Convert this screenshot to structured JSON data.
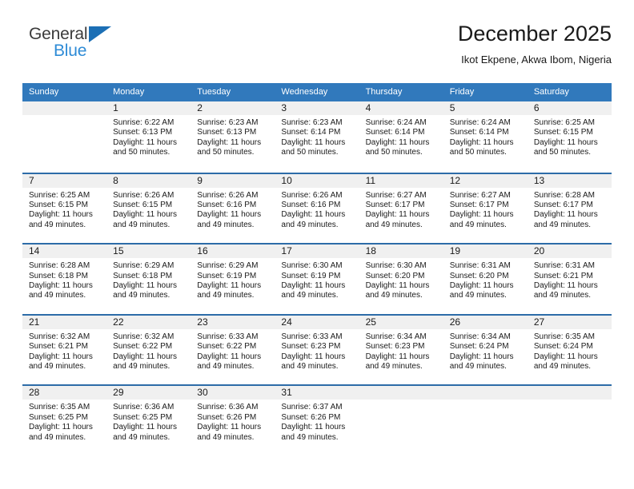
{
  "brand": {
    "name_part1": "General",
    "name_part2": "Blue",
    "accent_color": "#1c6fb5",
    "light_blue": "#2e8bd6"
  },
  "header": {
    "title": "December 2025",
    "subtitle": "Ikot Ekpene, Akwa Ibom, Nigeria"
  },
  "theme": {
    "header_row_bg": "#3179bc",
    "row_divider": "#2d6ca8",
    "daynum_bg": "#f0f0f0"
  },
  "weekdays": [
    "Sunday",
    "Monday",
    "Tuesday",
    "Wednesday",
    "Thursday",
    "Friday",
    "Saturday"
  ],
  "labels": {
    "sunrise_prefix": "Sunrise:",
    "sunset_prefix": "Sunset:",
    "daylight_prefix": "Daylight:"
  },
  "weeks": [
    [
      {
        "day": "",
        "empty": true
      },
      {
        "day": "1",
        "sunrise": "Sunrise: 6:22 AM",
        "sunset": "Sunset: 6:13 PM",
        "daylight1": "Daylight: 11 hours",
        "daylight2": "and 50 minutes."
      },
      {
        "day": "2",
        "sunrise": "Sunrise: 6:23 AM",
        "sunset": "Sunset: 6:13 PM",
        "daylight1": "Daylight: 11 hours",
        "daylight2": "and 50 minutes."
      },
      {
        "day": "3",
        "sunrise": "Sunrise: 6:23 AM",
        "sunset": "Sunset: 6:14 PM",
        "daylight1": "Daylight: 11 hours",
        "daylight2": "and 50 minutes."
      },
      {
        "day": "4",
        "sunrise": "Sunrise: 6:24 AM",
        "sunset": "Sunset: 6:14 PM",
        "daylight1": "Daylight: 11 hours",
        "daylight2": "and 50 minutes."
      },
      {
        "day": "5",
        "sunrise": "Sunrise: 6:24 AM",
        "sunset": "Sunset: 6:14 PM",
        "daylight1": "Daylight: 11 hours",
        "daylight2": "and 50 minutes."
      },
      {
        "day": "6",
        "sunrise": "Sunrise: 6:25 AM",
        "sunset": "Sunset: 6:15 PM",
        "daylight1": "Daylight: 11 hours",
        "daylight2": "and 50 minutes."
      }
    ],
    [
      {
        "day": "7",
        "sunrise": "Sunrise: 6:25 AM",
        "sunset": "Sunset: 6:15 PM",
        "daylight1": "Daylight: 11 hours",
        "daylight2": "and 49 minutes."
      },
      {
        "day": "8",
        "sunrise": "Sunrise: 6:26 AM",
        "sunset": "Sunset: 6:15 PM",
        "daylight1": "Daylight: 11 hours",
        "daylight2": "and 49 minutes."
      },
      {
        "day": "9",
        "sunrise": "Sunrise: 6:26 AM",
        "sunset": "Sunset: 6:16 PM",
        "daylight1": "Daylight: 11 hours",
        "daylight2": "and 49 minutes."
      },
      {
        "day": "10",
        "sunrise": "Sunrise: 6:26 AM",
        "sunset": "Sunset: 6:16 PM",
        "daylight1": "Daylight: 11 hours",
        "daylight2": "and 49 minutes."
      },
      {
        "day": "11",
        "sunrise": "Sunrise: 6:27 AM",
        "sunset": "Sunset: 6:17 PM",
        "daylight1": "Daylight: 11 hours",
        "daylight2": "and 49 minutes."
      },
      {
        "day": "12",
        "sunrise": "Sunrise: 6:27 AM",
        "sunset": "Sunset: 6:17 PM",
        "daylight1": "Daylight: 11 hours",
        "daylight2": "and 49 minutes."
      },
      {
        "day": "13",
        "sunrise": "Sunrise: 6:28 AM",
        "sunset": "Sunset: 6:17 PM",
        "daylight1": "Daylight: 11 hours",
        "daylight2": "and 49 minutes."
      }
    ],
    [
      {
        "day": "14",
        "sunrise": "Sunrise: 6:28 AM",
        "sunset": "Sunset: 6:18 PM",
        "daylight1": "Daylight: 11 hours",
        "daylight2": "and 49 minutes."
      },
      {
        "day": "15",
        "sunrise": "Sunrise: 6:29 AM",
        "sunset": "Sunset: 6:18 PM",
        "daylight1": "Daylight: 11 hours",
        "daylight2": "and 49 minutes."
      },
      {
        "day": "16",
        "sunrise": "Sunrise: 6:29 AM",
        "sunset": "Sunset: 6:19 PM",
        "daylight1": "Daylight: 11 hours",
        "daylight2": "and 49 minutes."
      },
      {
        "day": "17",
        "sunrise": "Sunrise: 6:30 AM",
        "sunset": "Sunset: 6:19 PM",
        "daylight1": "Daylight: 11 hours",
        "daylight2": "and 49 minutes."
      },
      {
        "day": "18",
        "sunrise": "Sunrise: 6:30 AM",
        "sunset": "Sunset: 6:20 PM",
        "daylight1": "Daylight: 11 hours",
        "daylight2": "and 49 minutes."
      },
      {
        "day": "19",
        "sunrise": "Sunrise: 6:31 AM",
        "sunset": "Sunset: 6:20 PM",
        "daylight1": "Daylight: 11 hours",
        "daylight2": "and 49 minutes."
      },
      {
        "day": "20",
        "sunrise": "Sunrise: 6:31 AM",
        "sunset": "Sunset: 6:21 PM",
        "daylight1": "Daylight: 11 hours",
        "daylight2": "and 49 minutes."
      }
    ],
    [
      {
        "day": "21",
        "sunrise": "Sunrise: 6:32 AM",
        "sunset": "Sunset: 6:21 PM",
        "daylight1": "Daylight: 11 hours",
        "daylight2": "and 49 minutes."
      },
      {
        "day": "22",
        "sunrise": "Sunrise: 6:32 AM",
        "sunset": "Sunset: 6:22 PM",
        "daylight1": "Daylight: 11 hours",
        "daylight2": "and 49 minutes."
      },
      {
        "day": "23",
        "sunrise": "Sunrise: 6:33 AM",
        "sunset": "Sunset: 6:22 PM",
        "daylight1": "Daylight: 11 hours",
        "daylight2": "and 49 minutes."
      },
      {
        "day": "24",
        "sunrise": "Sunrise: 6:33 AM",
        "sunset": "Sunset: 6:23 PM",
        "daylight1": "Daylight: 11 hours",
        "daylight2": "and 49 minutes."
      },
      {
        "day": "25",
        "sunrise": "Sunrise: 6:34 AM",
        "sunset": "Sunset: 6:23 PM",
        "daylight1": "Daylight: 11 hours",
        "daylight2": "and 49 minutes."
      },
      {
        "day": "26",
        "sunrise": "Sunrise: 6:34 AM",
        "sunset": "Sunset: 6:24 PM",
        "daylight1": "Daylight: 11 hours",
        "daylight2": "and 49 minutes."
      },
      {
        "day": "27",
        "sunrise": "Sunrise: 6:35 AM",
        "sunset": "Sunset: 6:24 PM",
        "daylight1": "Daylight: 11 hours",
        "daylight2": "and 49 minutes."
      }
    ],
    [
      {
        "day": "28",
        "sunrise": "Sunrise: 6:35 AM",
        "sunset": "Sunset: 6:25 PM",
        "daylight1": "Daylight: 11 hours",
        "daylight2": "and 49 minutes."
      },
      {
        "day": "29",
        "sunrise": "Sunrise: 6:36 AM",
        "sunset": "Sunset: 6:25 PM",
        "daylight1": "Daylight: 11 hours",
        "daylight2": "and 49 minutes."
      },
      {
        "day": "30",
        "sunrise": "Sunrise: 6:36 AM",
        "sunset": "Sunset: 6:26 PM",
        "daylight1": "Daylight: 11 hours",
        "daylight2": "and 49 minutes."
      },
      {
        "day": "31",
        "sunrise": "Sunrise: 6:37 AM",
        "sunset": "Sunset: 6:26 PM",
        "daylight1": "Daylight: 11 hours",
        "daylight2": "and 49 minutes."
      },
      {
        "day": "",
        "empty": true
      },
      {
        "day": "",
        "empty": true
      },
      {
        "day": "",
        "empty": true
      }
    ]
  ]
}
